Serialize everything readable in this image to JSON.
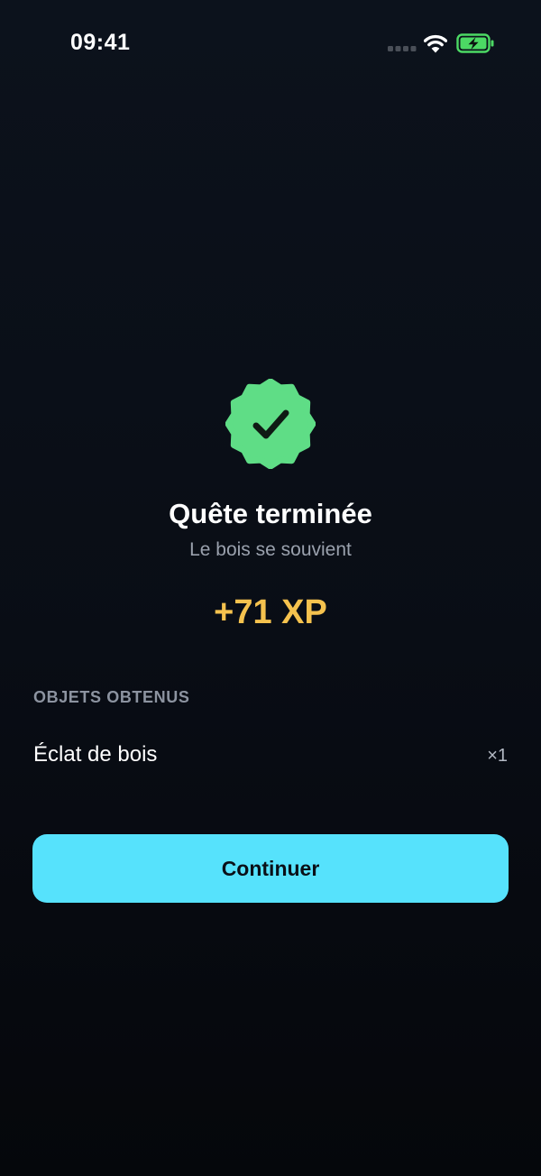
{
  "status_bar": {
    "time": "09:41",
    "signal_icon": "cellular-signal-icon",
    "wifi_icon": "wifi-icon",
    "battery_icon": "battery-charging-icon",
    "battery_color": "#4cd964"
  },
  "badge": {
    "icon": "verified-badge-check-icon",
    "color": "#5fdd86"
  },
  "title": "Quête terminée",
  "subtitle": "Le bois se souvient",
  "xp_reward": "+71 XP",
  "xp_color": "#f5c24e",
  "items_section": {
    "label": "OBJETS OBTENUS",
    "items": [
      {
        "name": "Éclat de bois",
        "quantity": "×1"
      }
    ]
  },
  "continue_button": {
    "label": "Continuer",
    "color": "#56e2fc"
  }
}
